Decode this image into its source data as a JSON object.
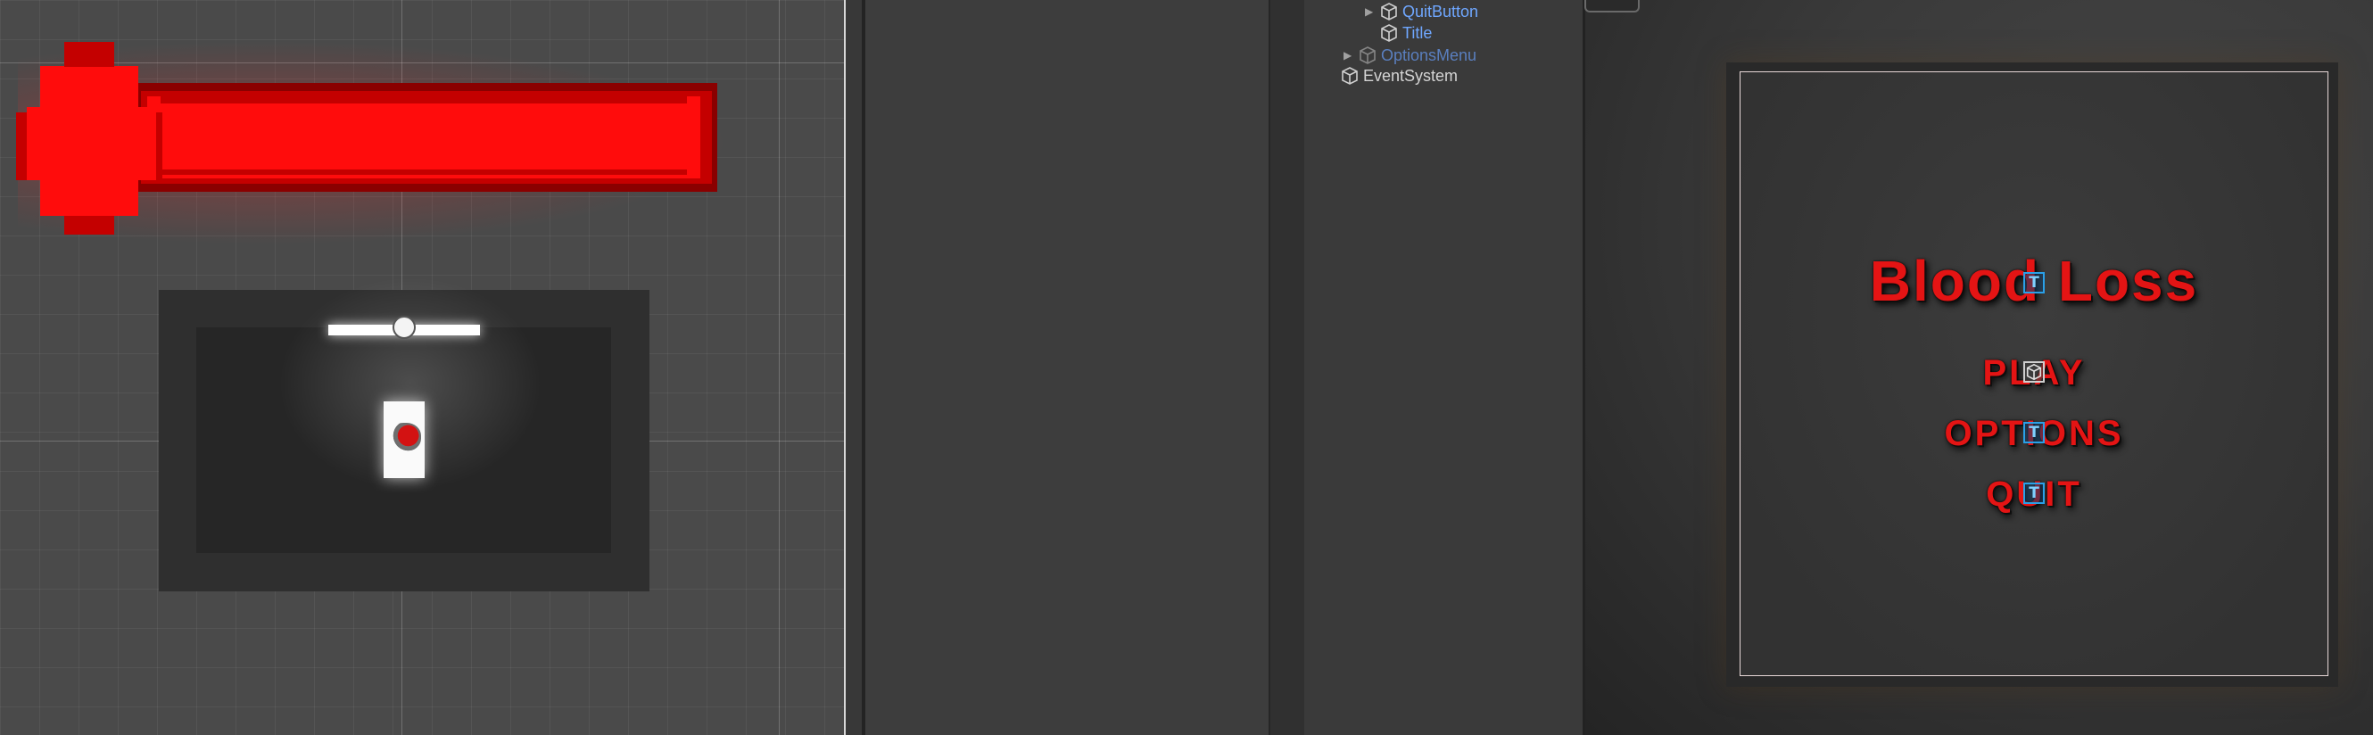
{
  "hierarchy": {
    "items": [
      {
        "label": "QuitButton",
        "style": "linked",
        "expandable": true
      },
      {
        "label": "Title",
        "style": "linked",
        "expandable": false
      },
      {
        "label": "OptionsMenu",
        "style": "inactive",
        "expandable": true
      },
      {
        "label": "EventSystem",
        "style": "normal",
        "expandable": false
      }
    ]
  },
  "game_view": {
    "title": "Blood Loss",
    "buttons": {
      "play": "PLAY",
      "options": "OPTIONS",
      "quit": "QUIT"
    },
    "text_gizmo": "T"
  },
  "colors": {
    "health_red": "#ff0c0c",
    "menu_red": "#e41414",
    "prefab_blue": "#6fa7ff",
    "gizmo_blue": "#2aa0e8"
  },
  "icons": {
    "hierarchy_object": "cube-icon",
    "expand": "triangle-right-icon",
    "text_gizmo": "text-icon",
    "button_gizmo": "cube-icon"
  }
}
